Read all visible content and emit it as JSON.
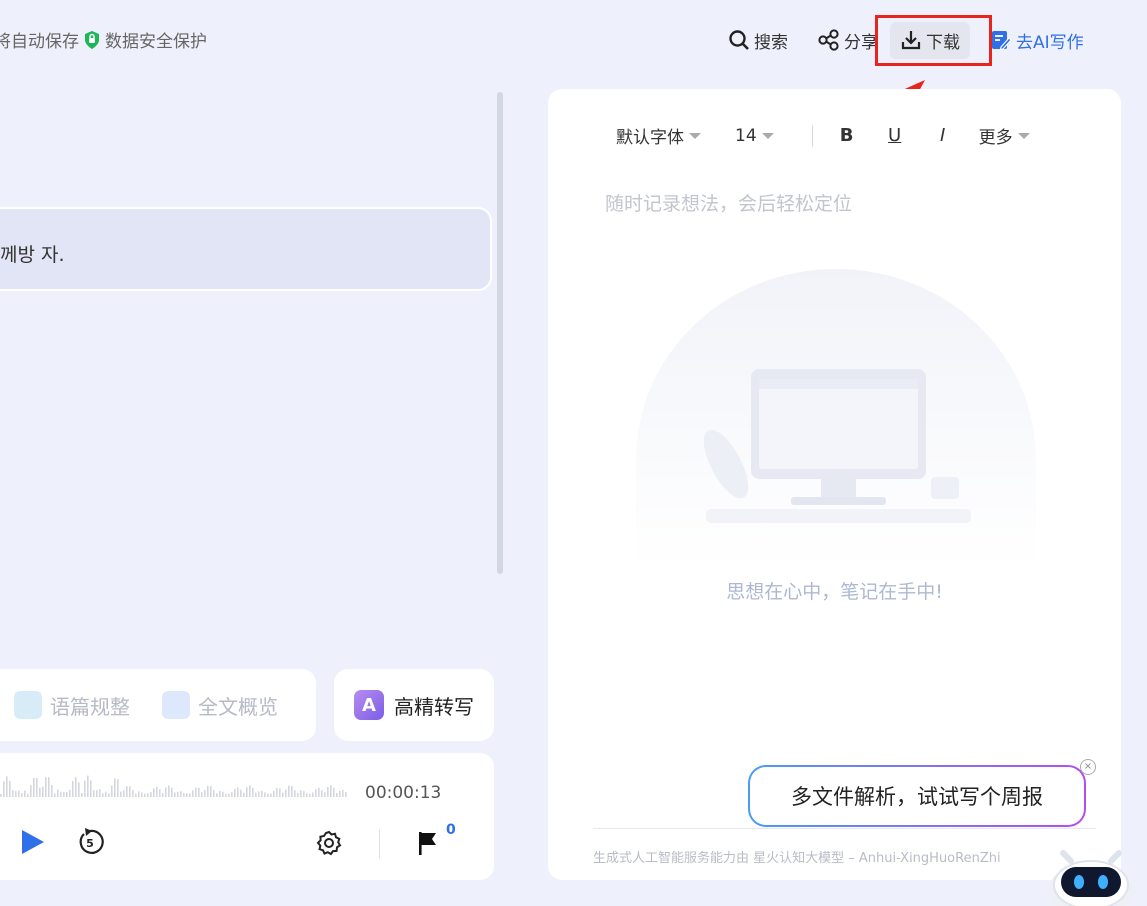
{
  "topbar": {
    "autosave_text": "将自动保存",
    "security_text": "数据安全保护",
    "search_label": "搜索",
    "share_label": "分享",
    "download_label": "下载",
    "ai_write_label": "去AI写作"
  },
  "transcript": {
    "bubble_text": "께방 자."
  },
  "tools": {
    "paragraph_label": "语篇规整",
    "overview_label": "全文概览",
    "hq_transcribe_label": "高精转写",
    "hq_icon_letter": "A"
  },
  "player": {
    "time": "00:00:13",
    "flag_count": "0"
  },
  "note": {
    "font_label": "默认字体",
    "size_label": "14",
    "bold_label": "B",
    "underline_label": "U",
    "italic_label": "I",
    "more_label": "更多",
    "placeholder": "随时记录想法，会后轻松定位",
    "empty_text": "思想在心中，笔记在手中!",
    "footer_text": "生成式人工智能服务能力由 星火认知大模型 – Anhui-XingHuoRenZhi"
  },
  "suggestion": {
    "text": "多文件解析，试试写个周报",
    "close_label": "×"
  },
  "colors": {
    "accent": "#2f6fe8",
    "highlight": "#e8241c",
    "background": "#eef1fb"
  }
}
